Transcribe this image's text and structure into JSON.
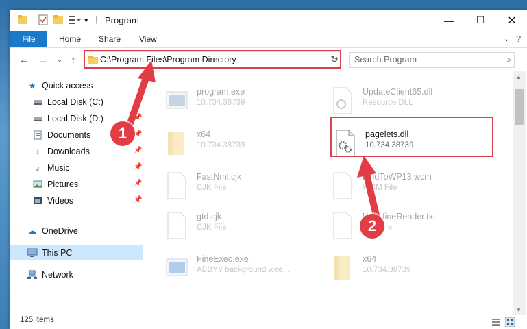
{
  "window": {
    "title": "Program"
  },
  "ribbon": {
    "file": "File",
    "tabs": [
      "Home",
      "Share",
      "View"
    ]
  },
  "nav": {
    "address": "C:\\Program Files\\Program Directory",
    "search_placeholder": "Search Program"
  },
  "sidebar": {
    "items": [
      {
        "label": "Quick access",
        "icon": "star-icon"
      },
      {
        "label": "Local Disk (C:)",
        "icon": "drive-icon"
      },
      {
        "label": "Local Disk (D:)",
        "icon": "drive-icon"
      },
      {
        "label": "Documents",
        "icon": "documents-icon"
      },
      {
        "label": "Downloads",
        "icon": "download-icon"
      },
      {
        "label": "Music",
        "icon": "music-icon"
      },
      {
        "label": "Pictures",
        "icon": "pictures-icon"
      },
      {
        "label": "Videos",
        "icon": "videos-icon"
      },
      {
        "label": "OneDrive",
        "icon": "cloud-icon"
      },
      {
        "label": "This PC",
        "icon": "pc-icon"
      },
      {
        "label": "Network",
        "icon": "network-icon"
      }
    ]
  },
  "files": [
    {
      "name": "program.exe",
      "sub": "10.734.38739",
      "icon": "exe-icon"
    },
    {
      "name": "UpdateClient65.dll",
      "sub": "Resource DLL",
      "icon": "dll-icon"
    },
    {
      "name": "x64",
      "sub": "10.734.38739",
      "icon": "folder-icon"
    },
    {
      "name": "pagelets.dll",
      "sub": "10.734.38739",
      "icon": "dll-gear-icon"
    },
    {
      "name": "FastNml.cjk",
      "sub": "CJK File",
      "icon": "file-icon"
    },
    {
      "name": "FindToWP13.wcm",
      "sub": "WCM File",
      "icon": "file-icon"
    },
    {
      "name": "gtd.cjk",
      "sub": "CJK File",
      "icon": "file-icon"
    },
    {
      "name": "Help.fineReader.txt",
      "sub": "TXT File",
      "icon": "file-icon"
    },
    {
      "name": "FineExec.exe",
      "sub": "ABBYY background wee...",
      "icon": "exe-icon"
    },
    {
      "name": "x64",
      "sub": "10.734.38739",
      "icon": "folder-icon"
    }
  ],
  "status": {
    "count": "125 items"
  },
  "callouts": {
    "one": "1",
    "two": "2"
  },
  "colors": {
    "accent": "#1979ca",
    "highlight": "#d9424b",
    "selected": "#cce8ff"
  }
}
